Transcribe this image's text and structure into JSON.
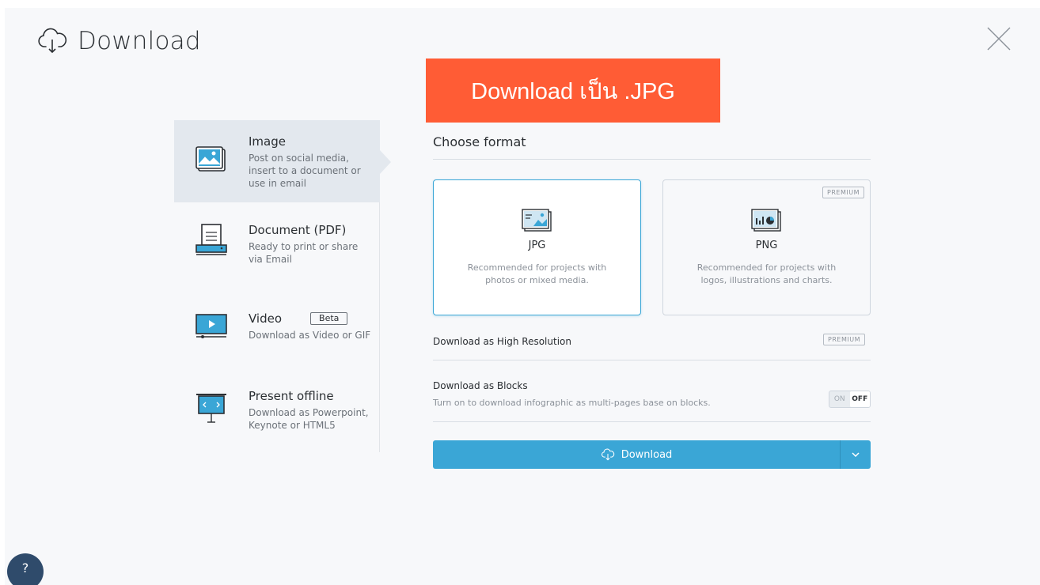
{
  "header": {
    "title": "Download",
    "icon": "cloud-download-icon"
  },
  "banner": {
    "text": "Download เป็น .JPG",
    "color": "#ff5c35"
  },
  "sidebar": {
    "items": [
      {
        "title": "Image",
        "desc_lines": [
          "Post on social media,",
          "insert to a document or",
          "use in email"
        ],
        "icon": "image-icon",
        "active": true
      },
      {
        "title": "Document (PDF)",
        "desc_lines": [
          "Ready to print or share",
          "via Email"
        ],
        "icon": "document-printer-icon"
      },
      {
        "title": "Video",
        "badge": "Beta",
        "desc_lines": [
          "Download as Video or GIF"
        ],
        "icon": "video-icon"
      },
      {
        "title": "Present offline",
        "desc_lines": [
          "Download as Powerpoint,",
          "Keynote or HTML5"
        ],
        "icon": "projector-icon"
      }
    ]
  },
  "main": {
    "section_title": "Choose format",
    "formats": [
      {
        "title": "JPG",
        "desc_lines": [
          "Recommended for projects with",
          "photos or mixed media."
        ],
        "selected": true,
        "icon": "jpg-photo-icon"
      },
      {
        "title": "PNG",
        "desc_lines": [
          "Recommended for projects with",
          "logos, illustrations and charts."
        ],
        "premium": "PREMIUM",
        "icon": "png-chart-icon"
      }
    ],
    "high_res": {
      "label": "Download as High Resolution",
      "premium": "PREMIUM"
    },
    "blocks": {
      "label": "Download as Blocks",
      "desc": "Turn on to download infographic as multi-pages base on blocks.",
      "on": "ON",
      "off": "OFF"
    },
    "download_button": {
      "label": "Download",
      "accent": "#3aa6d6"
    }
  },
  "help": {
    "label": "?"
  }
}
